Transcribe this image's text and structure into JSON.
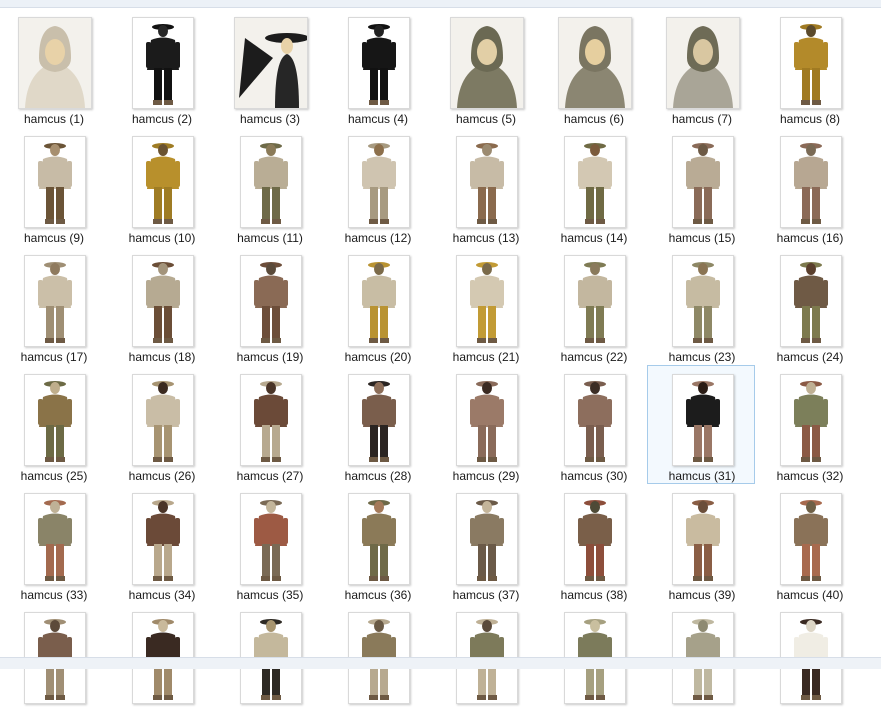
{
  "files": [
    {
      "name": "hamcus (1)",
      "kind": "portrait",
      "colors": [
        "#e0d8c8",
        "#c9bfab",
        "#e8d2a8"
      ]
    },
    {
      "name": "hamcus (2)",
      "kind": "full",
      "colors": [
        "#1b1b1b",
        "#111111",
        "#262626"
      ]
    },
    {
      "name": "hamcus (3)",
      "kind": "fan",
      "colors": [
        "#1c1c1c",
        "#262626",
        "#e8d2a8"
      ]
    },
    {
      "name": "hamcus (4)",
      "kind": "full",
      "colors": [
        "#161616",
        "#111111",
        "#222222"
      ]
    },
    {
      "name": "hamcus (5)",
      "kind": "portrait",
      "colors": [
        "#7d7a63",
        "#6b6953",
        "#e2cfa6"
      ]
    },
    {
      "name": "hamcus (6)",
      "kind": "portrait",
      "colors": [
        "#8b8672",
        "#7a7561",
        "#e6cf9f"
      ]
    },
    {
      "name": "hamcus (7)",
      "kind": "portrait",
      "colors": [
        "#a9a597",
        "#6e6b56",
        "#d9c7a1"
      ]
    },
    {
      "name": "hamcus (8)",
      "kind": "full",
      "colors": [
        "#b38a2a",
        "#a07a22",
        "#5b4a2c"
      ]
    },
    {
      "name": "hamcus (9)",
      "kind": "full",
      "colors": [
        "#c7bba6",
        "#6b5437",
        "#a78f6f"
      ]
    },
    {
      "name": "hamcus (10)",
      "kind": "full",
      "colors": [
        "#b8902c",
        "#9f7c24",
        "#6a5331"
      ]
    },
    {
      "name": "hamcus (11)",
      "kind": "full",
      "colors": [
        "#b9ad95",
        "#6e6a48",
        "#8a7a58"
      ]
    },
    {
      "name": "hamcus (12)",
      "kind": "full",
      "colors": [
        "#cfc4b0",
        "#a79a80",
        "#8c6f4b"
      ]
    },
    {
      "name": "hamcus (13)",
      "kind": "full",
      "colors": [
        "#c7bba6",
        "#8a6a4d",
        "#9b8a70"
      ]
    },
    {
      "name": "hamcus (14)",
      "kind": "full",
      "colors": [
        "#d3c8b3",
        "#6f6a44",
        "#7b5b3c"
      ]
    },
    {
      "name": "hamcus (15)",
      "kind": "full",
      "colors": [
        "#b9ab95",
        "#8a6b58",
        "#6d5a46"
      ]
    },
    {
      "name": "hamcus (16)",
      "kind": "full",
      "colors": [
        "#b7a792",
        "#8b6a57",
        "#7a6a55"
      ]
    },
    {
      "name": "hamcus (17)",
      "kind": "full",
      "colors": [
        "#cbbfa8",
        "#9f8f74",
        "#8f7a5e"
      ]
    },
    {
      "name": "hamcus (18)",
      "kind": "full",
      "colors": [
        "#b6aa92",
        "#6b4e37",
        "#a3947b"
      ]
    },
    {
      "name": "hamcus (19)",
      "kind": "full",
      "colors": [
        "#8a6a55",
        "#6d4e3a",
        "#5a4a3a"
      ]
    },
    {
      "name": "hamcus (20)",
      "kind": "full",
      "colors": [
        "#c8bda4",
        "#b99332",
        "#7b6a49"
      ]
    },
    {
      "name": "hamcus (21)",
      "kind": "full",
      "colors": [
        "#d4c9b2",
        "#c29b35",
        "#7a6a4a"
      ]
    },
    {
      "name": "hamcus (22)",
      "kind": "full",
      "colors": [
        "#c3b79f",
        "#7f7b54",
        "#8a7a5c"
      ]
    },
    {
      "name": "hamcus (23)",
      "kind": "full",
      "colors": [
        "#c6bba2",
        "#8e8866",
        "#8a7453"
      ]
    },
    {
      "name": "hamcus (24)",
      "kind": "full",
      "colors": [
        "#6f5a45",
        "#7d7a4e",
        "#5a3f2d"
      ]
    },
    {
      "name": "hamcus (25)",
      "kind": "full",
      "colors": [
        "#8a7348",
        "#6c6a45",
        "#bfae8c"
      ]
    },
    {
      "name": "hamcus (26)",
      "kind": "full",
      "colors": [
        "#c9bda6",
        "#a79472",
        "#3b2a20"
      ]
    },
    {
      "name": "hamcus (27)",
      "kind": "full",
      "colors": [
        "#6b4a38",
        "#b7a98f",
        "#4a3427"
      ]
    },
    {
      "name": "hamcus (28)",
      "kind": "full",
      "colors": [
        "#7a5e4c",
        "#2b2522",
        "#8c6d58"
      ]
    },
    {
      "name": "hamcus (29)",
      "kind": "full",
      "colors": [
        "#9b7a68",
        "#8a6b5a",
        "#3a2a22"
      ]
    },
    {
      "name": "hamcus (30)",
      "kind": "full",
      "colors": [
        "#8d6e5d",
        "#7a5e4f",
        "#3c2d25"
      ]
    },
    {
      "name": "hamcus (31)",
      "kind": "full",
      "colors": [
        "#1c1c1c",
        "#9a7766",
        "#2a1c15"
      ]
    },
    {
      "name": "hamcus (32)",
      "kind": "full",
      "colors": [
        "#7c7f5a",
        "#8b5a45",
        "#bfb094"
      ]
    },
    {
      "name": "hamcus (33)",
      "kind": "full",
      "colors": [
        "#8a8468",
        "#a36a4f",
        "#bfb196"
      ]
    },
    {
      "name": "hamcus (34)",
      "kind": "full",
      "colors": [
        "#6b4a38",
        "#b9a88c",
        "#4a3427"
      ]
    },
    {
      "name": "hamcus (35)",
      "kind": "full",
      "colors": [
        "#9d5a44",
        "#7a6a55",
        "#c3b69b"
      ]
    },
    {
      "name": "hamcus (36)",
      "kind": "full",
      "colors": [
        "#8b7a58",
        "#6f6a48",
        "#a57a5a"
      ]
    },
    {
      "name": "hamcus (37)",
      "kind": "full",
      "colors": [
        "#8a7a62",
        "#6b5a48",
        "#c4b59a"
      ]
    },
    {
      "name": "hamcus (38)",
      "kind": "full",
      "colors": [
        "#7a5f49",
        "#8d4e3b",
        "#4e4a36"
      ]
    },
    {
      "name": "hamcus (39)",
      "kind": "full",
      "colors": [
        "#c9bba0",
        "#8a5e45",
        "#6b4e3a"
      ]
    },
    {
      "name": "hamcus (40)",
      "kind": "full",
      "colors": [
        "#8a7258",
        "#a86a4e",
        "#6f6046"
      ]
    },
    {
      "name": "",
      "kind": "partial",
      "colors": [
        "#7a5e4c",
        "#a08f75",
        "#5c4a3a"
      ]
    },
    {
      "name": "",
      "kind": "partial",
      "colors": [
        "#3a2a22",
        "#a08a6a",
        "#c9b99b"
      ]
    },
    {
      "name": "",
      "kind": "partial",
      "colors": [
        "#c4b89c",
        "#2e2a24",
        "#a8956f"
      ]
    },
    {
      "name": "",
      "kind": "partial",
      "colors": [
        "#8a7a5a",
        "#b7a98f",
        "#6a5a45"
      ]
    },
    {
      "name": "",
      "kind": "partial",
      "colors": [
        "#7d7a5a",
        "#bfb196",
        "#5a4a3a"
      ]
    },
    {
      "name": "",
      "kind": "partial",
      "colors": [
        "#7c7b5b",
        "#a6a080",
        "#c9bf9f"
      ]
    },
    {
      "name": "",
      "kind": "partial",
      "colors": [
        "#a6a18a",
        "#bfb8a0",
        "#8e8a72"
      ]
    },
    {
      "name": "",
      "kind": "partial",
      "colors": [
        "#f0ede4",
        "#3a2a22",
        "#ddd6c6"
      ]
    }
  ],
  "selected_index": 30
}
